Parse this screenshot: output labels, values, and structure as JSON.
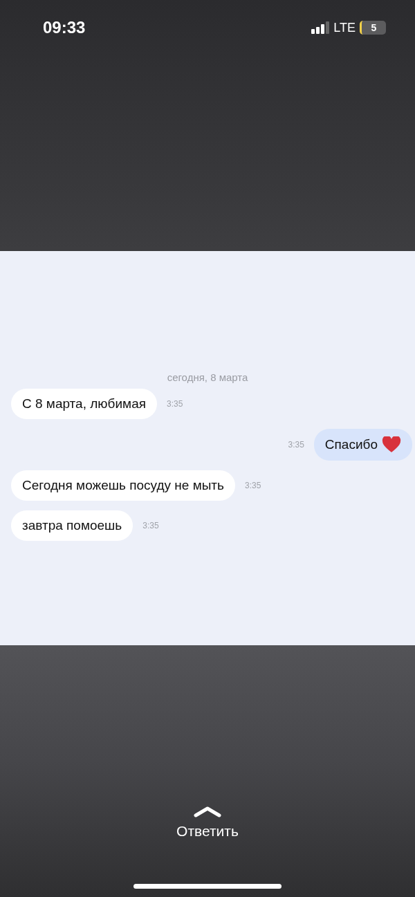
{
  "status_bar": {
    "time": "09:33",
    "network": "LTE",
    "battery": "5"
  },
  "chat": {
    "date": "сегодня, 8 марта",
    "messages": [
      {
        "kind": "incoming",
        "text": "С 8 марта, любимая",
        "time": "3:35"
      },
      {
        "kind": "outgoing",
        "text": "Спасибо",
        "time": "3:35",
        "heart": true
      },
      {
        "kind": "incoming",
        "text": "Сегодня можешь посуду не мыть",
        "time": "3:35"
      },
      {
        "kind": "incoming",
        "text": "завтра помоешь",
        "time": "3:35"
      }
    ]
  },
  "reply": {
    "label": "Ответить"
  }
}
